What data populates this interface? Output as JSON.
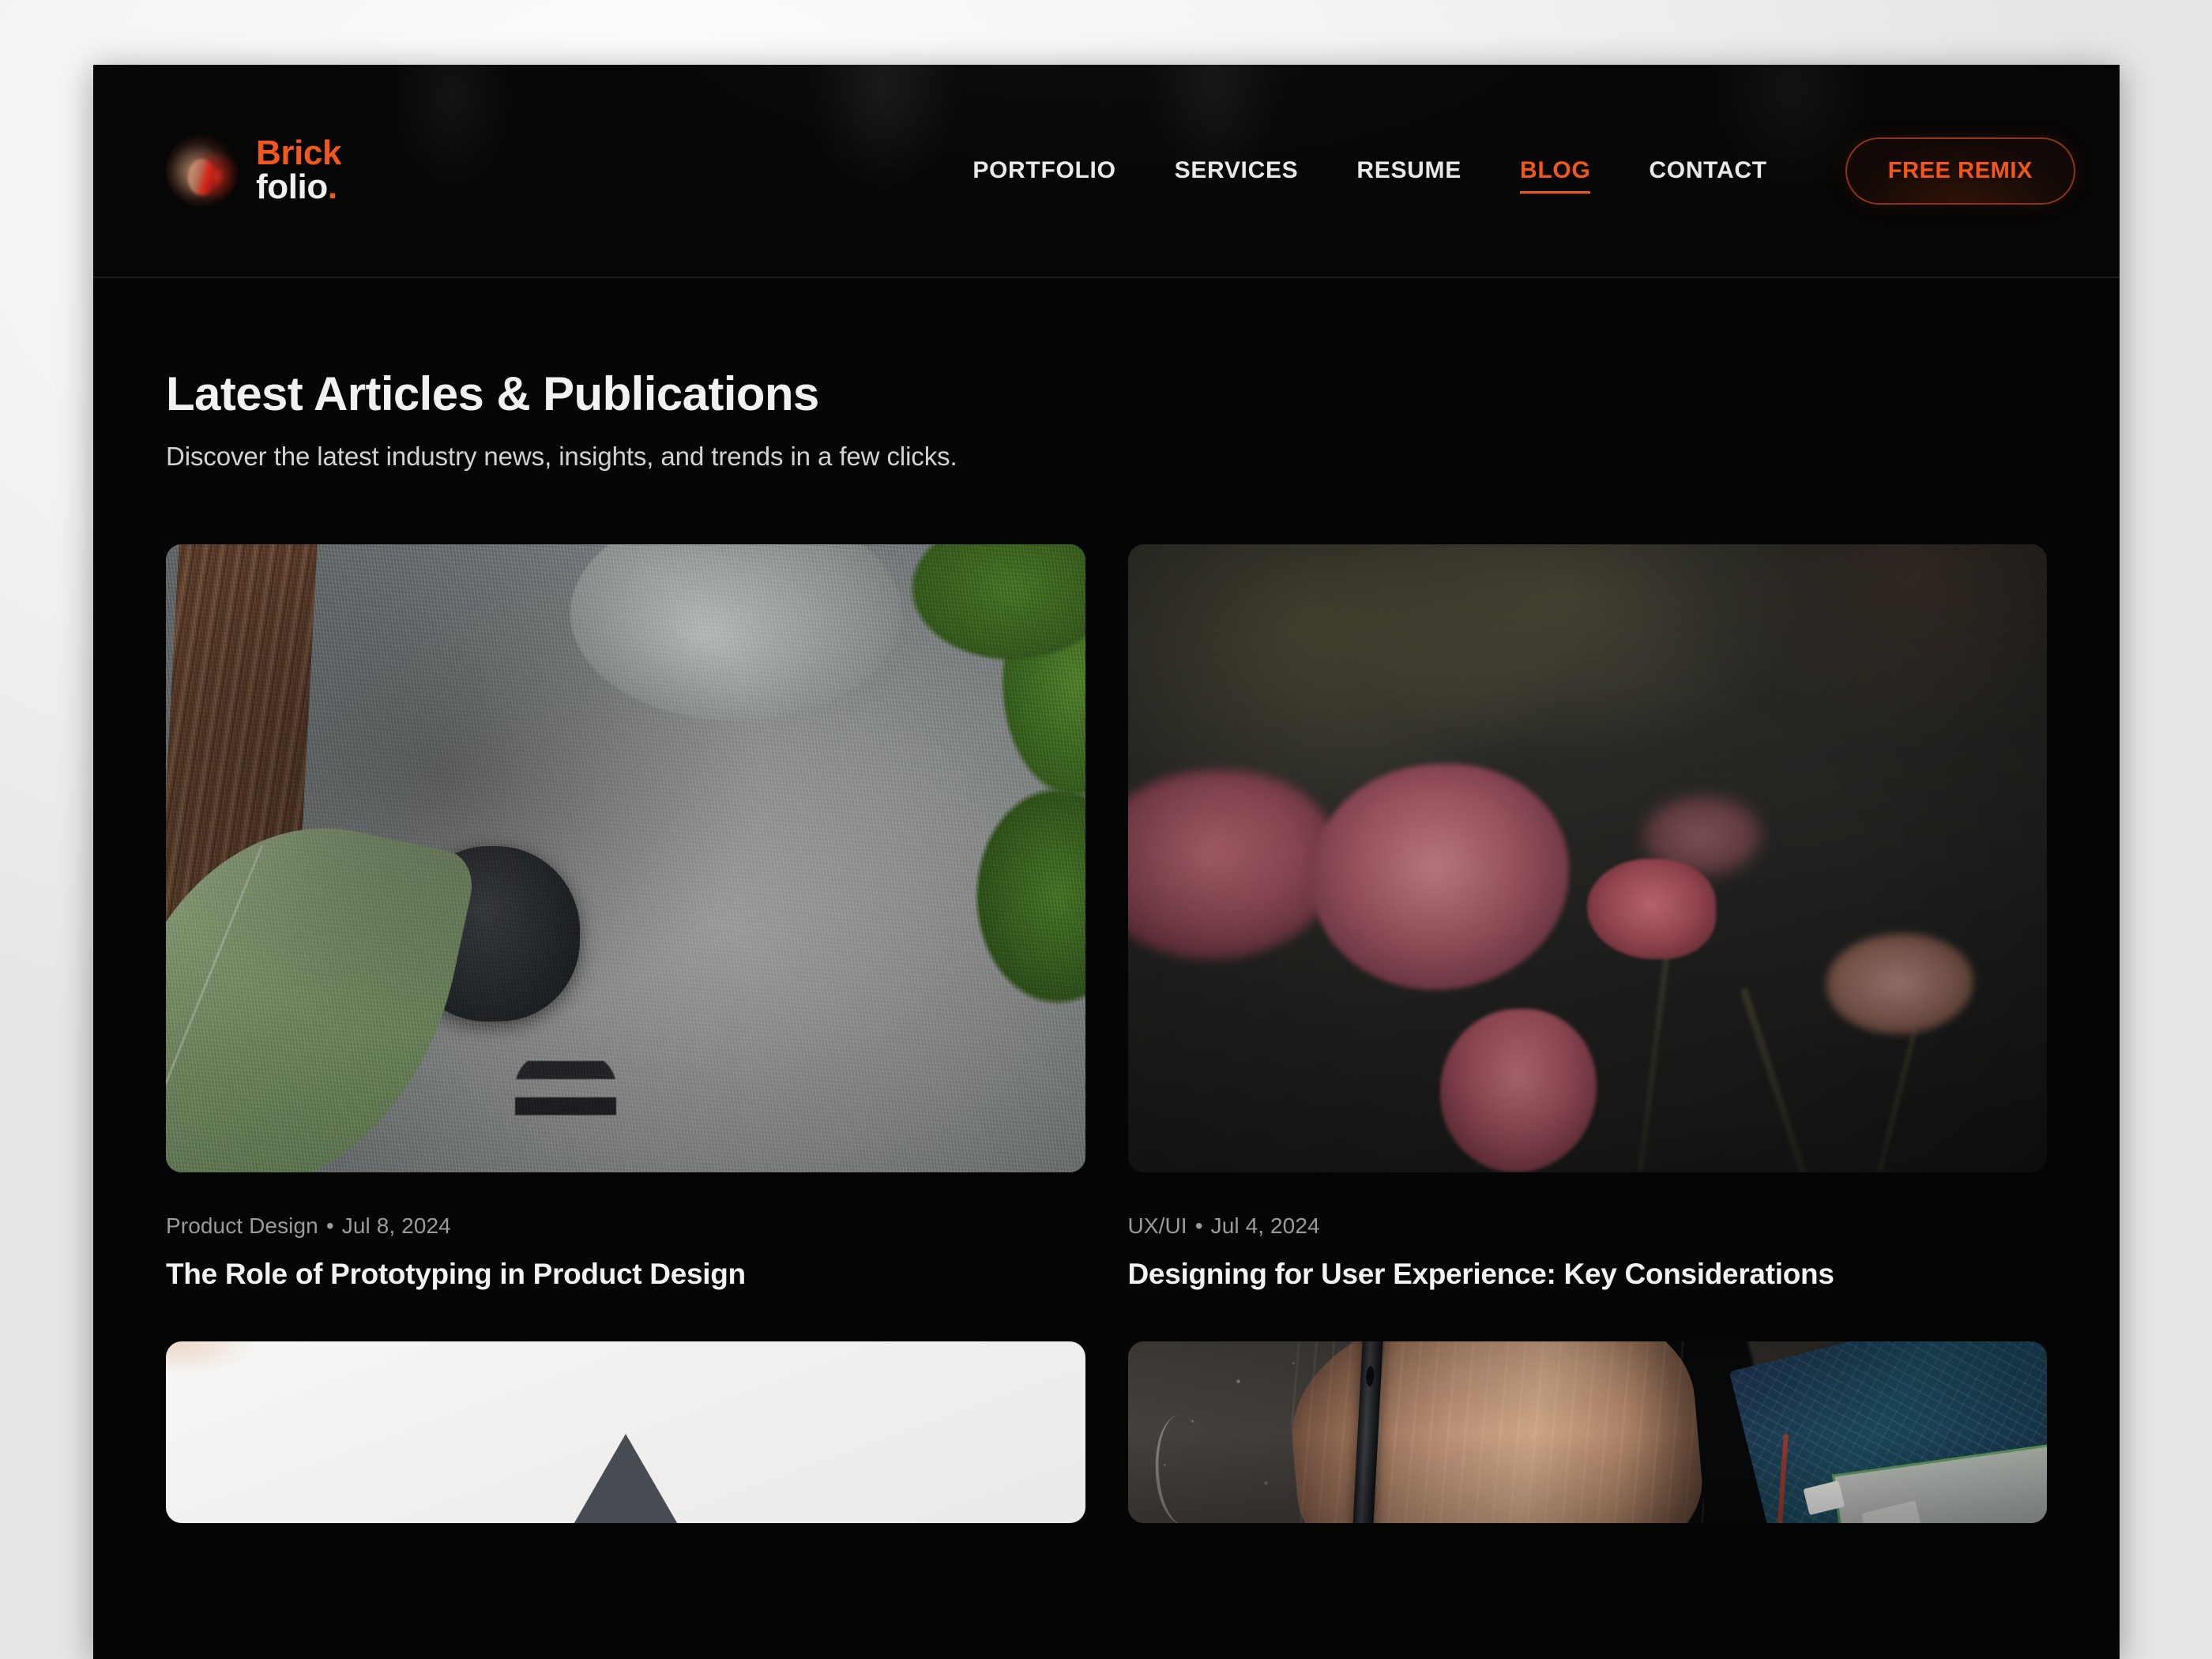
{
  "header": {
    "brand": {
      "line1": "Brick",
      "line2": "folio",
      "dot": ".",
      "avatar_icon": "portrait-avatar-icon"
    },
    "nav": [
      {
        "label": "PORTFOLIO",
        "active": false
      },
      {
        "label": "SERVICES",
        "active": false
      },
      {
        "label": "RESUME",
        "active": false
      },
      {
        "label": "BLOG",
        "active": true
      },
      {
        "label": "CONTACT",
        "active": false
      }
    ],
    "cta_label": "FREE REMIX"
  },
  "main": {
    "title": "Latest Articles & Publications",
    "subtitle": "Discover the latest industry news, insights, and trends in a few clicks.",
    "articles": [
      {
        "category": "Product Design",
        "separator": "•",
        "date": "Jul 8, 2024",
        "title": "The Role of Prototyping in Product Design",
        "image": "sleeping-koala-photo"
      },
      {
        "category": "UX/UI",
        "separator": "•",
        "date": "Jul 4, 2024",
        "title": "Designing for User Experience: Key Considerations",
        "image": "dark-moody-roses-photo"
      },
      {
        "image": "white-laptop-photo"
      },
      {
        "image": "hand-with-tool-circuit-board-photo"
      }
    ]
  },
  "colors": {
    "accent": "#f4571a",
    "background": "#050505",
    "page_surround": "#f1f1f1",
    "text_primary": "#f2f2f2",
    "text_muted": "#9b9b9b"
  }
}
